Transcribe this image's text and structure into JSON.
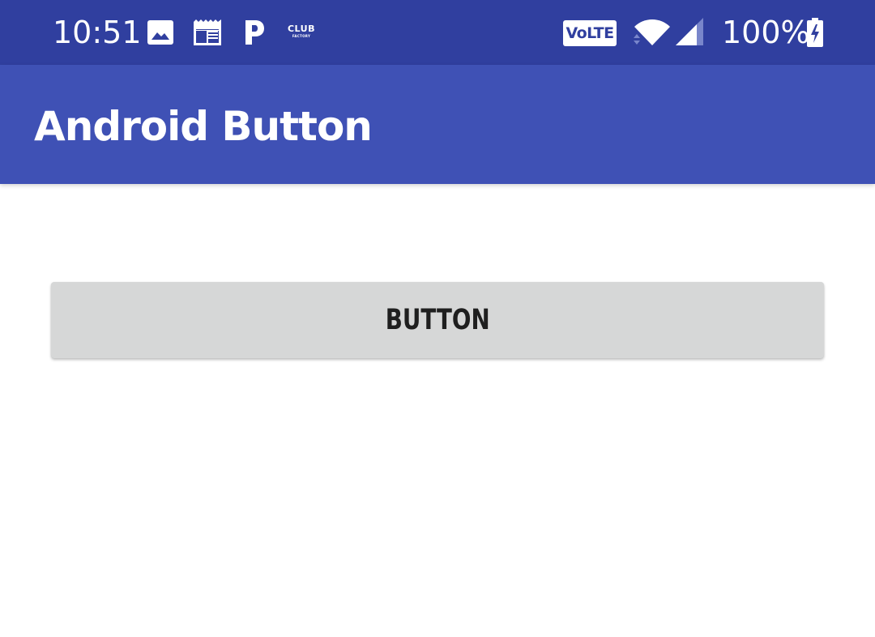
{
  "status_bar": {
    "time": "10:51",
    "notification_icons": [
      "gallery-icon",
      "news-icon",
      "paytm-p-icon",
      "club-factory-icon"
    ],
    "club_factory": {
      "line1": "CLUB",
      "line2": "FACTORY"
    },
    "volte_label": "VoLTE",
    "wifi": "wifi-full-icon",
    "signal": "cell-signal-icon",
    "battery_percent": "100%",
    "battery": "battery-charging-icon",
    "background_color": "#303f9f"
  },
  "app_bar": {
    "title": "Android Button",
    "background_color": "#3f51b5"
  },
  "main": {
    "button_label": "BUTTON",
    "button_color": "#d6d7d7"
  }
}
